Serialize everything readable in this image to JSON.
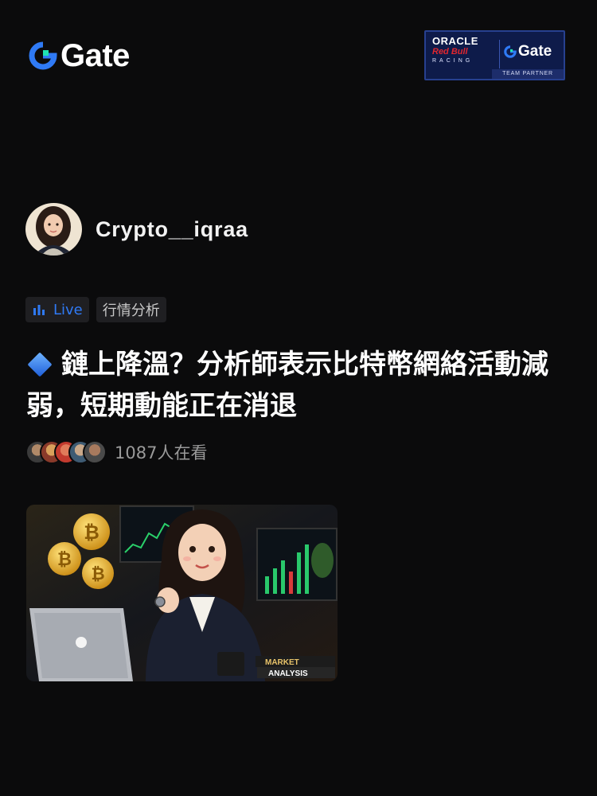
{
  "brand": {
    "name": "Gate"
  },
  "partner_badge": {
    "oracle": "ORACLE",
    "redbull": "Red Bull",
    "racing": "RACING",
    "gate": "Gate",
    "team_partner": "TEAM PARTNER"
  },
  "author": {
    "name": "Crypto__iqraa"
  },
  "tags": {
    "live": "Live",
    "category": "行情分析"
  },
  "post": {
    "title": "鏈上降溫？分析師表示比特幣網絡活動減弱，短期動能正在消退"
  },
  "viewers": {
    "count_text": "1087人在看"
  },
  "thumbnail": {
    "caption_line1": "MARKET",
    "caption_line2": "ANALYSIS"
  },
  "colors": {
    "background": "#0b0b0c",
    "accent_blue": "#2f7af5",
    "tag_bg": "#1f1f22",
    "muted_text": "#9a9a9a"
  }
}
